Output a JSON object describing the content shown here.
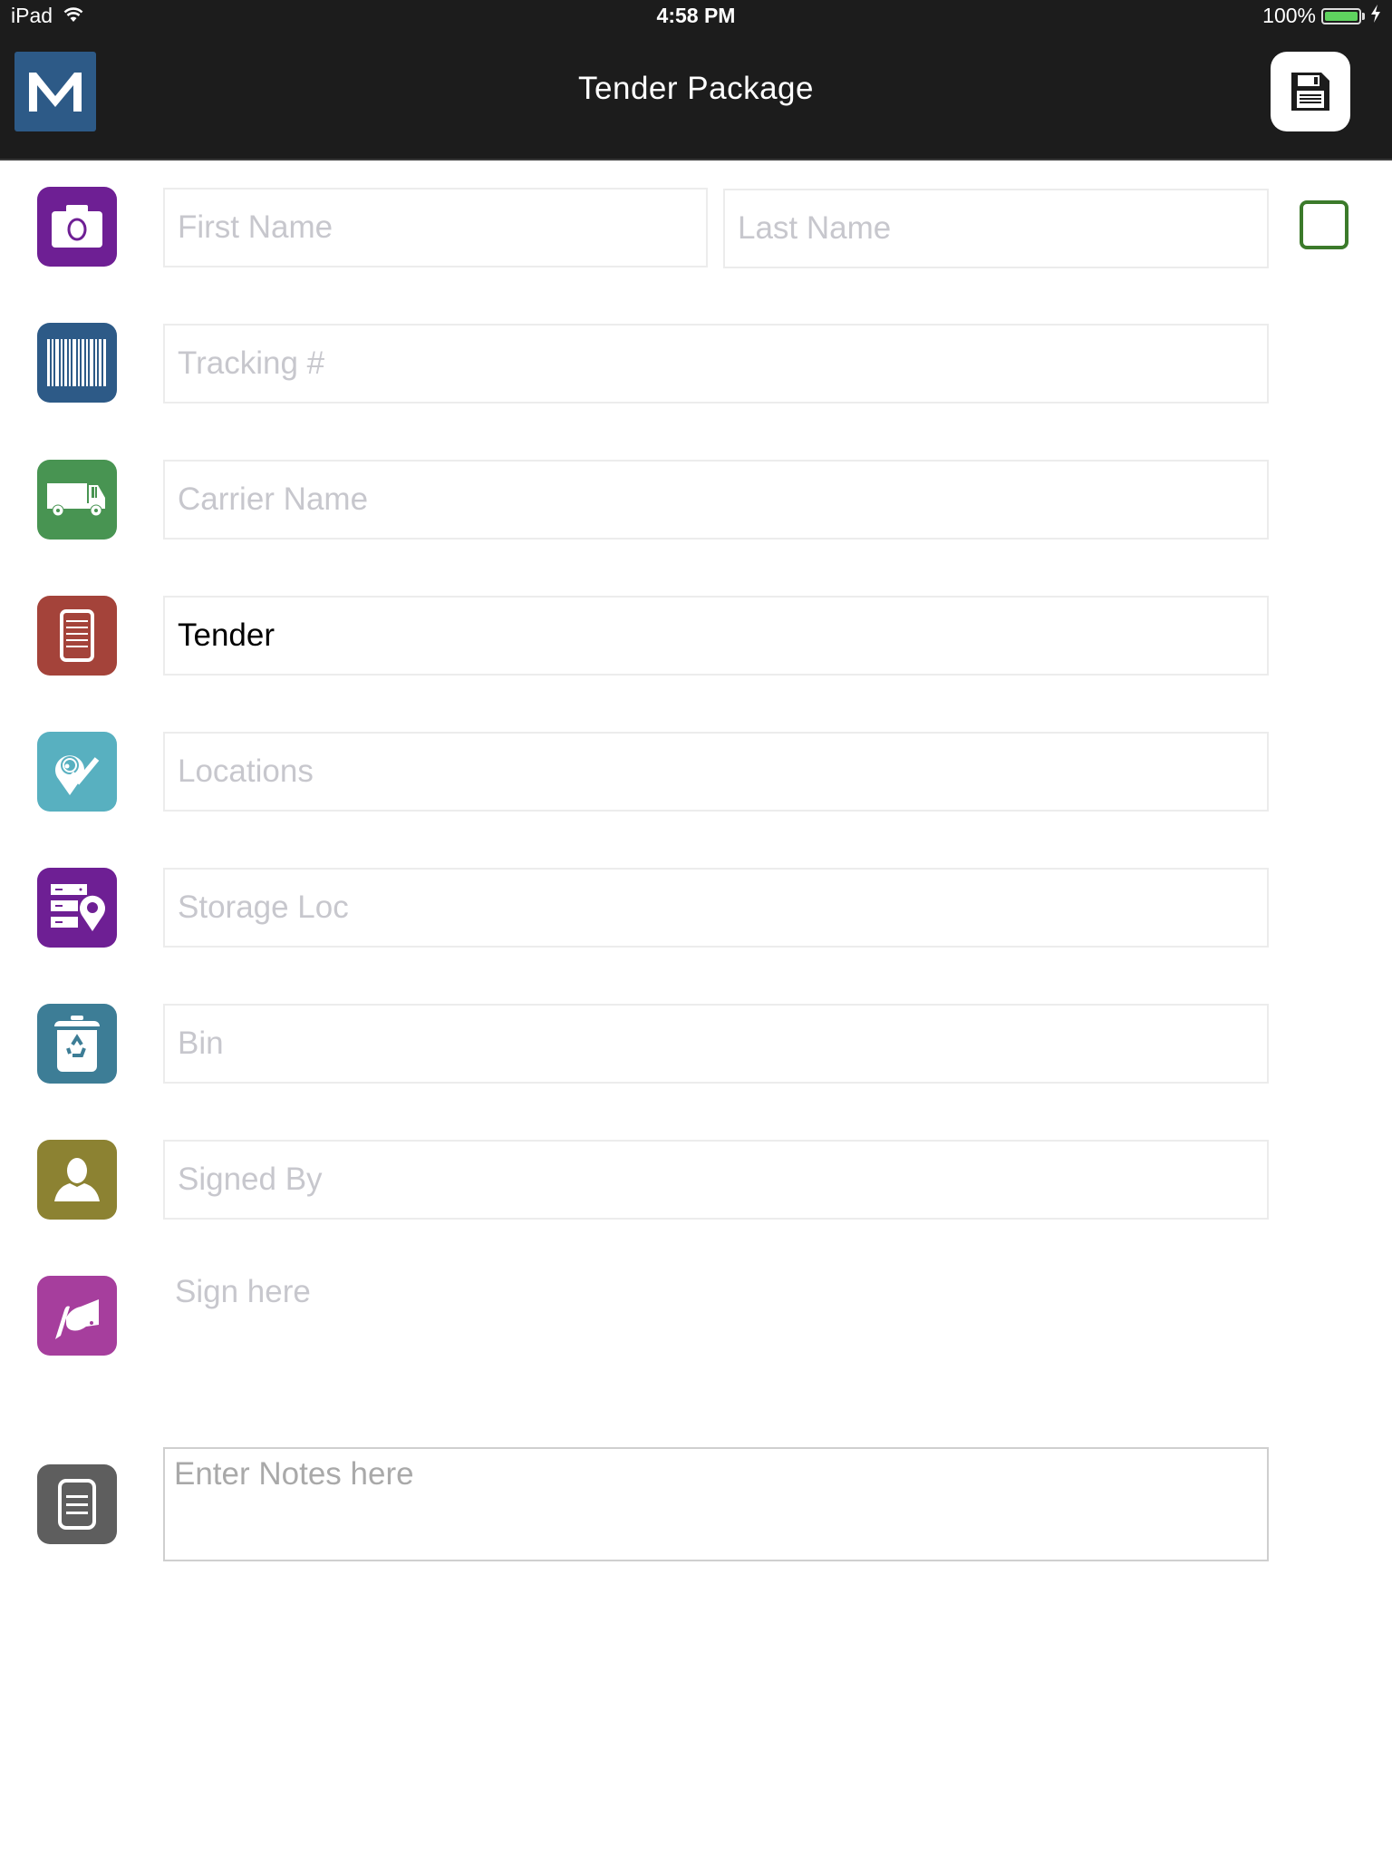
{
  "status_bar": {
    "device": "iPad",
    "time": "4:58 PM",
    "battery_percent": "100%",
    "battery_level": 1.0
  },
  "header": {
    "logo_letter": "M",
    "title": "Tender Package",
    "save_icon": "floppy-disk-icon"
  },
  "colors": {
    "header_bg": "#1c1c1c",
    "logo_bg": "#2d5a87",
    "checkbox_border": "#3b7a2a"
  },
  "form": {
    "first_name": {
      "placeholder": "First Name",
      "value": "",
      "icon": "camera-icon",
      "icon_color": "#6e1f94"
    },
    "last_name": {
      "placeholder": "Last Name",
      "value": ""
    },
    "tracking": {
      "placeholder": "Tracking #",
      "value": "",
      "icon": "barcode-icon",
      "icon_color": "#2d5a87"
    },
    "carrier": {
      "placeholder": "Carrier Name",
      "value": "",
      "icon": "truck-icon",
      "icon_color": "#489452"
    },
    "tender": {
      "placeholder": "",
      "value": "Tender",
      "icon": "package-list-icon",
      "icon_color": "#a4433a"
    },
    "locations": {
      "placeholder": "Locations",
      "value": "",
      "icon": "location-check-icon",
      "icon_color": "#58b0c0"
    },
    "storage_loc": {
      "placeholder": "Storage Loc",
      "value": "",
      "icon": "storage-location-icon",
      "icon_color": "#6e1f94"
    },
    "bin": {
      "placeholder": "Bin",
      "value": "",
      "icon": "recycle-bin-icon",
      "icon_color": "#3d7d96"
    },
    "signed_by": {
      "placeholder": "Signed By",
      "value": "",
      "icon": "person-icon",
      "icon_color": "#8c8232"
    },
    "signature": {
      "label": "Sign here",
      "icon": "signature-hand-icon",
      "icon_color": "#a63e9d"
    },
    "notes": {
      "placeholder": "Enter Notes here",
      "value": "",
      "icon": "notes-icon",
      "icon_color": "#5e5e5e"
    }
  }
}
